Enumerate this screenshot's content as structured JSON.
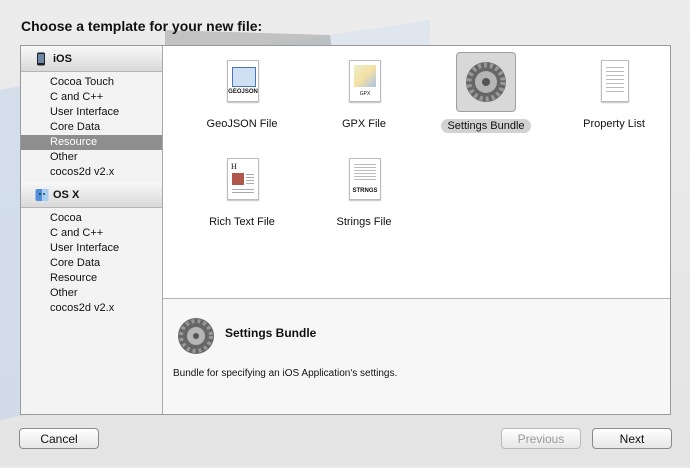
{
  "dialog": {
    "title": "Choose a template for your new file:"
  },
  "sidebar": {
    "sections": [
      {
        "name": "iOS",
        "icon": "ios-device-icon",
        "items": [
          "Cocoa Touch",
          "C and C++",
          "User Interface",
          "Core Data",
          "Resource",
          "Other",
          "cocos2d v2.x"
        ],
        "selected": "Resource"
      },
      {
        "name": "OS X",
        "icon": "osx-finder-icon",
        "items": [
          "Cocoa",
          "C and C++",
          "User Interface",
          "Core Data",
          "Resource",
          "Other",
          "cocos2d v2.x"
        ]
      }
    ]
  },
  "templates": [
    {
      "label": "GeoJSON File",
      "icon": "geojson-file-icon",
      "badge": "GEOJSON"
    },
    {
      "label": "GPX File",
      "icon": "gpx-file-icon",
      "badge": "GPX"
    },
    {
      "label": "Settings Bundle",
      "icon": "settings-gear-icon",
      "selected": true
    },
    {
      "label": "Property List",
      "icon": "property-list-icon"
    },
    {
      "label": "Rich Text File",
      "icon": "rich-text-file-icon"
    },
    {
      "label": "Strings File",
      "icon": "strings-file-icon",
      "badge": "STRNGS"
    }
  ],
  "description": {
    "title": "Settings Bundle",
    "text": "Bundle for specifying an iOS Application's settings.",
    "icon": "settings-gear-icon"
  },
  "buttons": {
    "cancel": "Cancel",
    "previous": "Previous",
    "next": "Next"
  },
  "colors": {
    "selection": "#8e8e8e",
    "panel_border": "#9a9a9a"
  }
}
